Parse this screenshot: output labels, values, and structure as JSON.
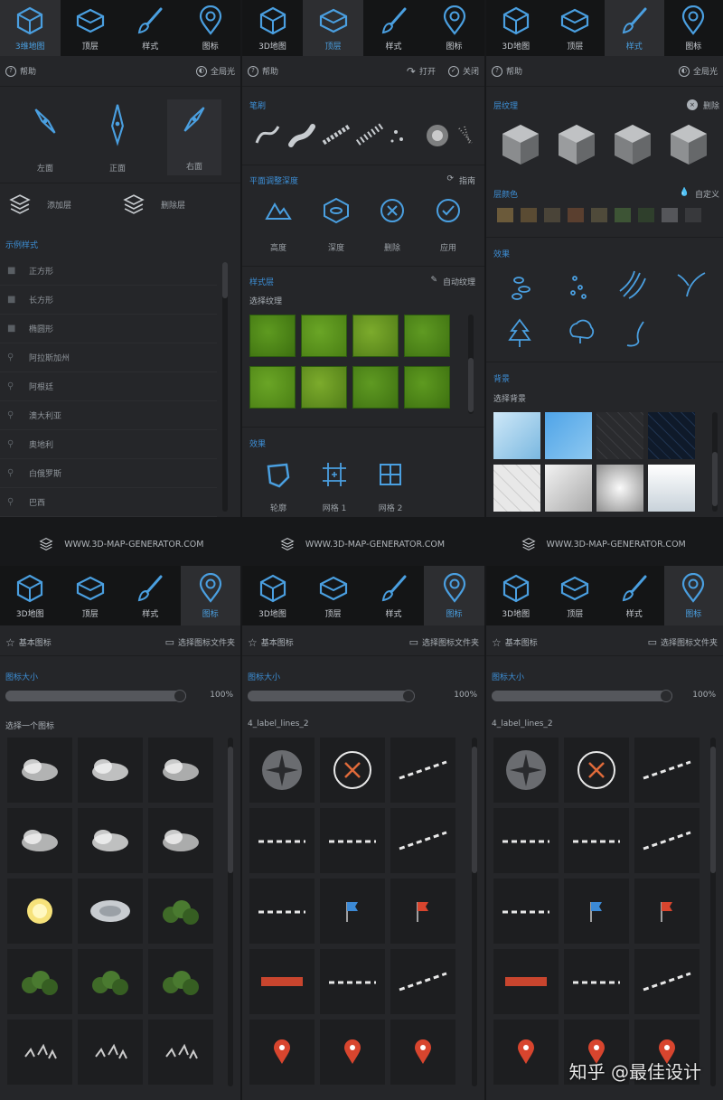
{
  "panels": [
    {
      "tabs": [
        "3维地图",
        "顶层",
        "样式",
        "图标"
      ],
      "active": 0
    },
    {
      "tabs": [
        "3D地图",
        "顶层",
        "样式",
        "图标"
      ],
      "active": 1
    },
    {
      "tabs": [
        "3D地图",
        "顶层",
        "样式",
        "图标"
      ],
      "active": 2
    }
  ],
  "p1": {
    "help": "帮助",
    "global_light": "全局光",
    "views": [
      "左面",
      "正面",
      "右面"
    ],
    "add_layer": "添加层",
    "del_layer": "删除层",
    "examples_title": "示例样式",
    "examples": [
      "正方形",
      "长方形",
      "椭圆形",
      "阿拉斯加州",
      "阿根廷",
      "澳大利亚",
      "奥地利",
      "白俄罗斯",
      "巴西"
    ]
  },
  "p2": {
    "help": "帮助",
    "open": "打开",
    "close": "关闭",
    "brush_title": "笔刷",
    "adjust_title": "平面调整深度",
    "guide": "指南",
    "adjust": [
      "高度",
      "深度",
      "删除",
      "应用"
    ],
    "style_title": "样式层",
    "auto_texture": "自动纹理",
    "select_texture": "选择纹理",
    "effect_title": "效果",
    "effects": [
      "轮廓",
      "网格 1",
      "网格 2"
    ]
  },
  "p3": {
    "help": "帮助",
    "global_light": "全局光",
    "texture_title": "层纹理",
    "delete": "删除",
    "color_title": "层颜色",
    "custom": "自定义",
    "swatches": [
      "#6b5a3a",
      "#5a4b33",
      "#4a4438",
      "#5a3f2f",
      "#4f4a3a",
      "#3d5435",
      "#2f3f2c",
      "#55565a",
      "#38393c"
    ],
    "effect_title": "效果",
    "bg_title": "背景",
    "select_bg": "选择背景"
  },
  "banner": "WWW.3D-MAP-GENERATOR.COM",
  "bottom": [
    {
      "tabs": [
        "3D地图",
        "顶层",
        "样式",
        "图标"
      ],
      "active": 3,
      "basic": "基本图标",
      "folder": "选择图标文件夹",
      "size_title": "图标大小",
      "percent": "100%",
      "pick": "选择一个图标"
    },
    {
      "tabs": [
        "3D地图",
        "顶层",
        "样式",
        "图标"
      ],
      "active": 3,
      "basic": "基本图标",
      "folder": "选择图标文件夹",
      "size_title": "图标大小",
      "percent": "100%",
      "pick": "4_label_lines_2"
    },
    {
      "tabs": [
        "3D地图",
        "顶层",
        "样式",
        "图标"
      ],
      "active": 3,
      "basic": "基本图标",
      "folder": "选择图标文件夹",
      "size_title": "图标大小",
      "percent": "100%",
      "pick": "4_label_lines_2"
    }
  ],
  "size_value": 1.0,
  "watermark": "知乎 @最佳设计",
  "colors": {
    "accent": "#3d8fd6",
    "panel": "#252629",
    "tabbar": "#141516"
  }
}
